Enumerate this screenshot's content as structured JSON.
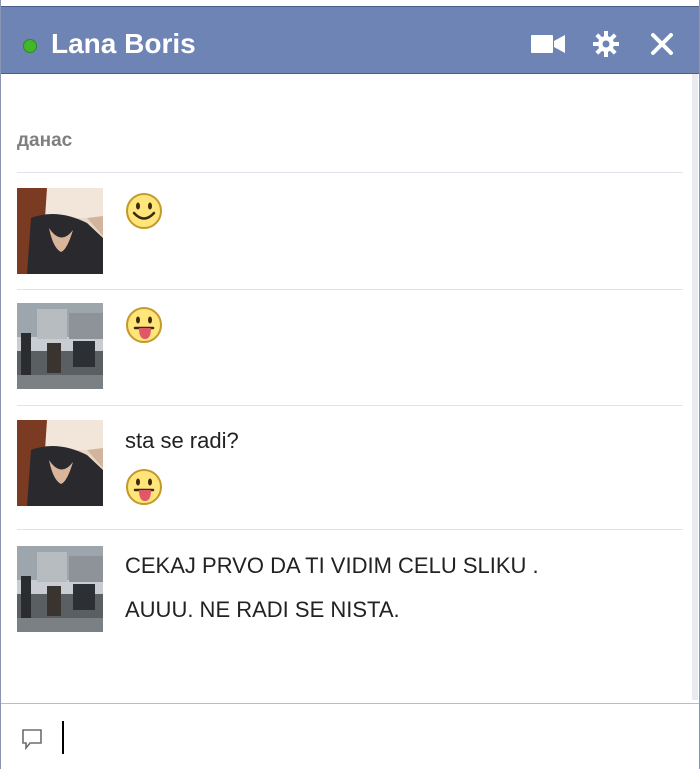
{
  "header": {
    "contact_name": "Lana Boris",
    "status_color": "#42b72a",
    "icons": [
      "video-call-icon",
      "gear-icon",
      "close-icon"
    ]
  },
  "conversation": {
    "date_separator": "данас",
    "messages": [
      {
        "sender_avatar": "avatar-woman-dark-top",
        "emoticon": "smile-emoticon"
      },
      {
        "sender_avatar": "avatar-street-photo",
        "emoticon": "tongue-emoticon"
      },
      {
        "sender_avatar": "avatar-woman-dark-top",
        "text": "sta se radi?",
        "emoticon": "tongue-emoticon"
      },
      {
        "sender_avatar": "avatar-street-photo",
        "lines": [
          "CEKAJ PRVO DA TI VIDIM CELU SLIKU .",
          "AUUU. NE RADI SE NISTA."
        ]
      }
    ]
  },
  "composer": {
    "value": "",
    "emoticon_button": "emoticon-picker-icon"
  },
  "colors": {
    "header_bg": "#6d84b4",
    "text": "#222222",
    "date": "#7f7f7f"
  }
}
